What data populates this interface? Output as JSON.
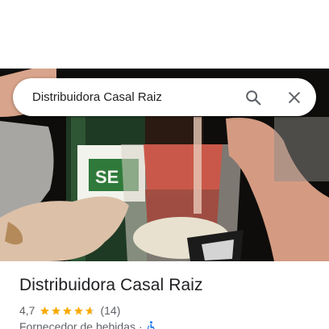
{
  "search": {
    "query": "Distribuidora Casal Raiz",
    "search_icon": "search-icon",
    "close_icon": "close-icon"
  },
  "photo": {
    "bottle_label_text": "SE"
  },
  "place": {
    "name": "Distribuidora Casal Raiz",
    "rating": "4,7",
    "stars_rating": 4.7,
    "review_count": "(14)",
    "category": "Fornecedor de bebidas",
    "separator": "·",
    "accessibility_icon": "wheelchair-accessible-icon"
  },
  "colors": {
    "star": "#f9ab00",
    "accessibility": "#1a73e8",
    "icon_gray": "#5f6368"
  }
}
